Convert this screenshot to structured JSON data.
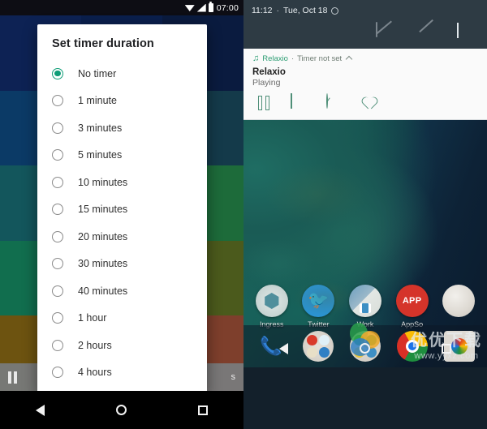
{
  "left_phone": {
    "status_bar": {
      "time": "07:00",
      "icons": [
        "wifi-icon",
        "signal-icon",
        "battery-icon"
      ]
    },
    "dialog": {
      "title": "Set timer duration",
      "options": [
        {
          "label": "No timer",
          "selected": true
        },
        {
          "label": "1 minute",
          "selected": false
        },
        {
          "label": "3 minutes",
          "selected": false
        },
        {
          "label": "5 minutes",
          "selected": false
        },
        {
          "label": "10 minutes",
          "selected": false
        },
        {
          "label": "15 minutes",
          "selected": false
        },
        {
          "label": "20 minutes",
          "selected": false
        },
        {
          "label": "30 minutes",
          "selected": false
        },
        {
          "label": "40 minutes",
          "selected": false
        },
        {
          "label": "1 hour",
          "selected": false
        },
        {
          "label": "2 hours",
          "selected": false
        },
        {
          "label": "4 hours",
          "selected": false
        }
      ],
      "accent_color": "#0f9d77"
    },
    "bottom_bar": {
      "trailing_text": "s"
    },
    "nav_bar": {
      "back": "back-icon",
      "home": "home-icon",
      "recents": "recents-icon"
    }
  },
  "right_phone": {
    "quick_settings": {
      "time": "11:12",
      "separator": "·",
      "date": "Tue, Oct 18",
      "alarm_icon": "alarm-icon",
      "tiles": [
        {
          "name": "wifi-tile",
          "state": "on"
        },
        {
          "name": "signal-tile",
          "state": "on"
        },
        {
          "name": "fingerprint-tile",
          "state": "on"
        },
        {
          "name": "cast-off-tile",
          "state": "off"
        },
        {
          "name": "flashlight-off-tile",
          "state": "off"
        },
        {
          "name": "expand-chevron",
          "state": "on"
        }
      ]
    },
    "notification": {
      "app_name": "Relaxio",
      "separator": "·",
      "status": "Timer not set",
      "title": "Relaxio",
      "subtitle": "Playing",
      "accent_color": "#2e9e74",
      "actions": [
        {
          "name": "pause-button",
          "label": "Pause"
        },
        {
          "name": "stop-button",
          "label": "Stop"
        },
        {
          "name": "timer-button",
          "label": "Timer"
        },
        {
          "name": "favorite-button",
          "label": "Favorite"
        }
      ]
    },
    "home_screen": {
      "apps": [
        {
          "label": "Ingress",
          "icon": "ingress-icon"
        },
        {
          "label": "Twitter",
          "icon": "twitter-icon"
        },
        {
          "label": "Work",
          "icon": "work-folder-icon"
        },
        {
          "label": "AppSo",
          "icon": "appso-icon",
          "badge_text": "APP"
        },
        {
          "label": "",
          "icon": "shell-icon"
        }
      ],
      "drawer_handle": "app-drawer-chevron",
      "dock": [
        {
          "name": "phone-dock-icon"
        },
        {
          "name": "media-folder-dock-icon"
        },
        {
          "name": "social-folder-dock-icon"
        },
        {
          "name": "chrome-dock-icon"
        },
        {
          "name": "photos-dock-icon"
        }
      ]
    },
    "watermark": {
      "brand": "优优下载",
      "url": "www.yyxz.com"
    },
    "nav_bar": {
      "back": "back-icon",
      "home": "home-icon",
      "recents": "recents-icon"
    }
  }
}
